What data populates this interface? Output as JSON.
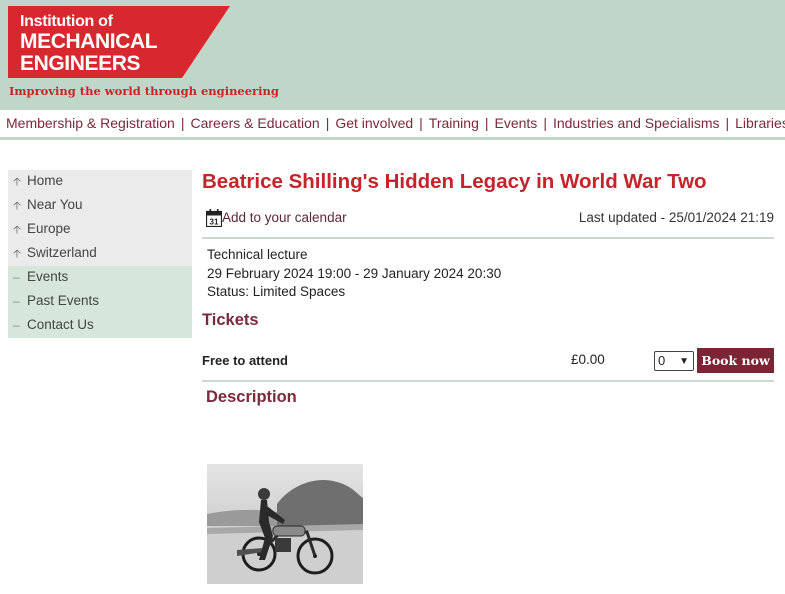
{
  "brand": {
    "logo_line1": "Institution of",
    "logo_line2": "MECHANICAL",
    "logo_line3": "ENGINEERS",
    "tagline": "Improving the world through engineering",
    "accent": "#c6242b",
    "header_bg": "#bfd6c8"
  },
  "topnav": {
    "items": [
      "Membership & Registration",
      "Careers & Education",
      "Get involved",
      "Training",
      "Events",
      "Industries and Specialisms",
      "Libraries &"
    ],
    "separator": "|"
  },
  "sidebar": {
    "items": [
      {
        "label": "Home",
        "icon": "arrow-up-icon"
      },
      {
        "label": "Near You",
        "icon": "arrow-up-icon"
      },
      {
        "label": "Europe",
        "icon": "arrow-up-icon"
      },
      {
        "label": "Switzerland",
        "icon": "arrow-up-icon"
      },
      {
        "label": "Events",
        "icon": "dash-icon"
      },
      {
        "label": "Past Events",
        "icon": "dash-icon"
      },
      {
        "label": "Contact Us",
        "icon": "dash-icon"
      }
    ]
  },
  "event": {
    "title": "Beatrice Shilling's Hidden Legacy in World War Two",
    "calendar_link": "Add to your calendar",
    "calendar_icon_day": "31",
    "last_updated": "Last updated - 25/01/2024 21:19",
    "type": "Technical lecture",
    "dates": "29 February 2024 19:00 - 29 January 2024 20:30",
    "status": "Status: Limited Spaces"
  },
  "tickets": {
    "heading": "Tickets",
    "label": "Free to attend",
    "price": "£0.00",
    "quantity": "0",
    "book_label": "Book now",
    "book_color": "#7d2434"
  },
  "description": {
    "heading": "Description",
    "image_alt": "Black and white photo of a woman on a racing motorcycle"
  }
}
